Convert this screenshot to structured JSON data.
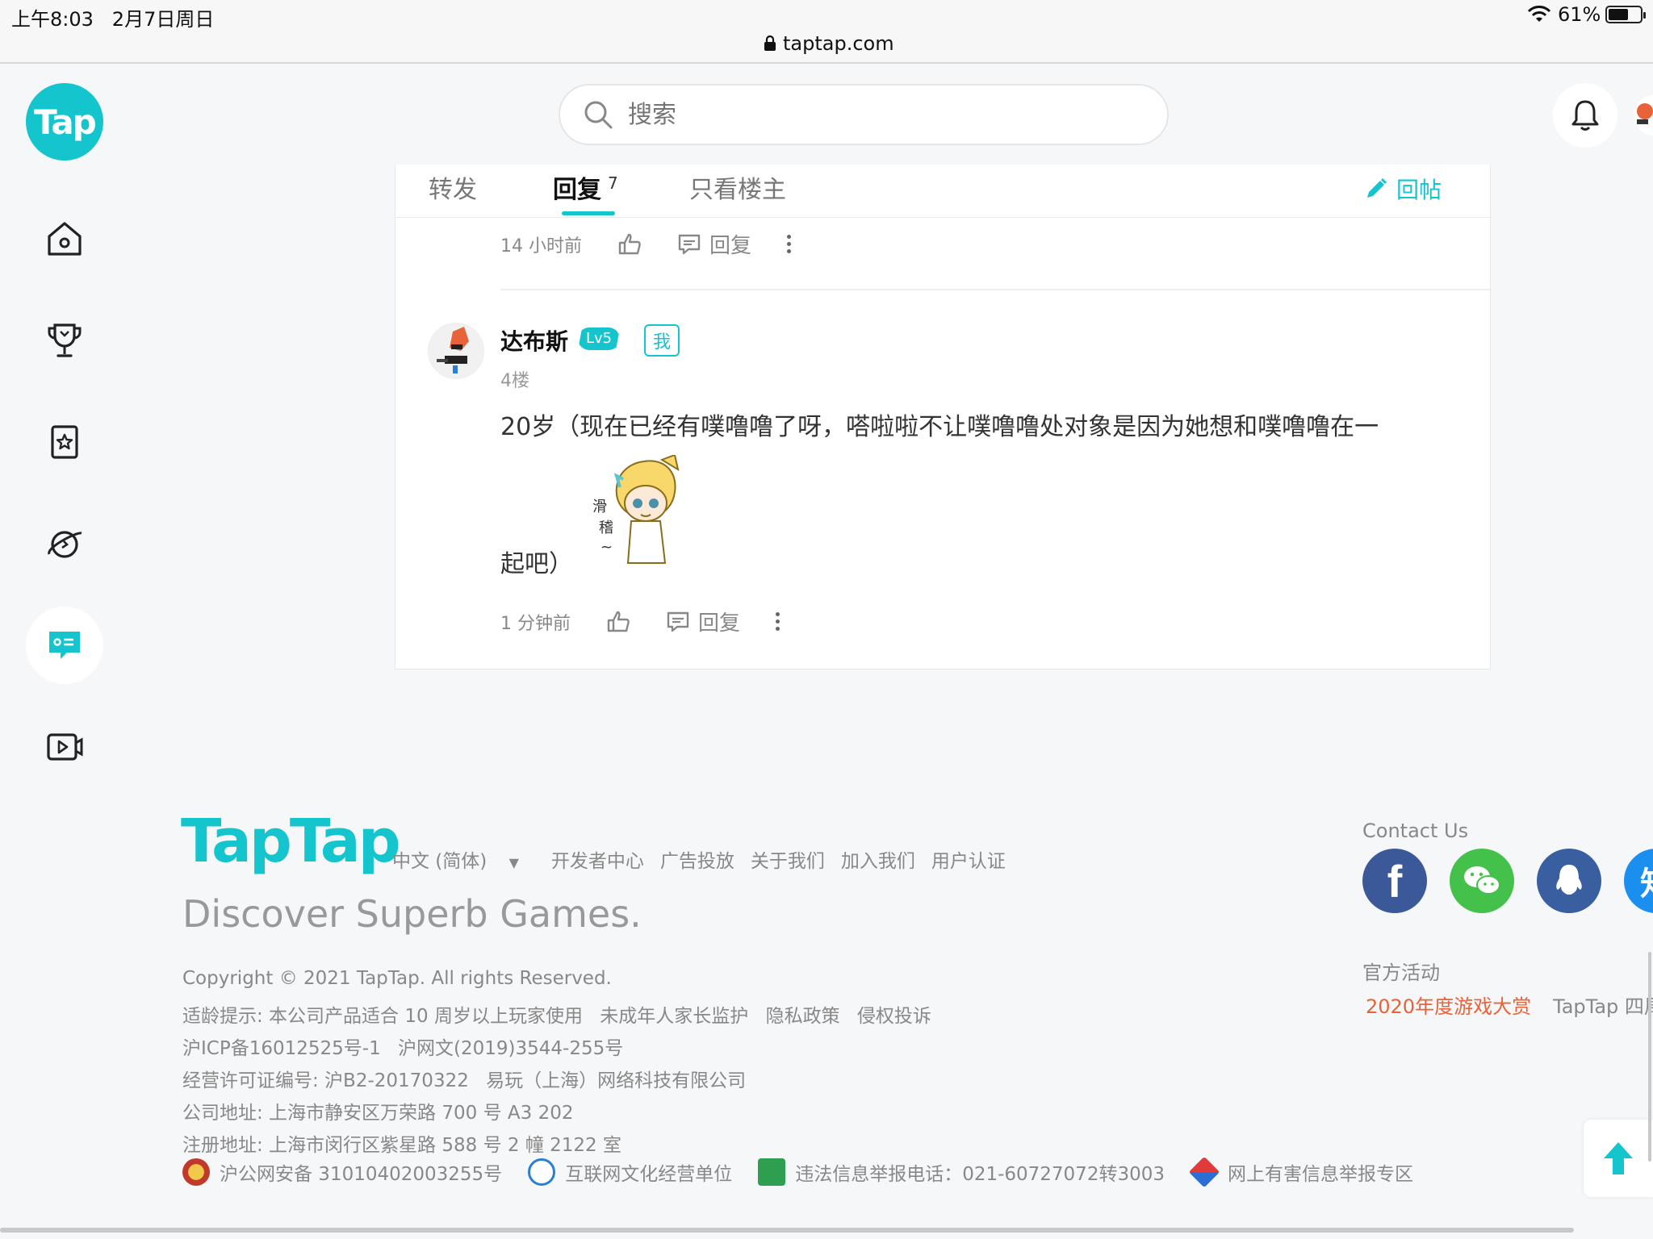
{
  "status_bar": {
    "time": "上午8:03",
    "date": "2月7日周日",
    "url": "taptap.com",
    "battery": "61%"
  },
  "header": {
    "logo_text": "Tap",
    "search_placeholder": "搜索"
  },
  "tabs": {
    "forward": "转发",
    "reply": "回复",
    "reply_count": "7",
    "owner_only": "只看楼主",
    "post_reply": "回帖"
  },
  "prev_comment": {
    "time": "14 小时前",
    "reply_label": "回复"
  },
  "comment": {
    "username": "达布斯",
    "level": "Lv5",
    "me_badge": "我",
    "floor": "4楼",
    "text_line1": "20岁（现在已经有噗噜噜了呀，嗒啦啦不让噗噜噜处对象是因为她想和噗噜噜在一",
    "text_line2": "起吧）",
    "time": "1 分钟前",
    "reply_label": "回复"
  },
  "footer": {
    "brand": "TapTap",
    "links": [
      "中文 (简体)",
      "开发者中心",
      "广告投放",
      "关于我们",
      "加入我们",
      "用户认证"
    ],
    "slogan": "Discover Superb Games.",
    "copyright": "Copyright © 2021 TapTap. All rights Reserved.",
    "age_notice": "适龄提示: 本公司产品适合 10 周岁以上玩家使用",
    "age_links": [
      "未成年人家长监护",
      "隐私政策",
      "侵权投诉"
    ],
    "icp": "沪ICP备16012525号-1",
    "net_culture": "沪网文(2019)3544-255号",
    "license": "经营许可证编号: 沪B2-20170322",
    "company": "易玩（上海）网络科技有限公司",
    "address": "公司地址: 上海市静安区万荣路 700 号 A3 202",
    "reg_address": "注册地址: 上海市闵行区紫星路 588 号 2 幢 2122 室",
    "police": "沪公网安备 31010402003255号",
    "culture_unit": "互联网文化经营单位",
    "report_phone": "违法信息举报电话：021-60727072转3003",
    "harmful_report": "网上有害信息举报专区",
    "contact_title": "Contact Us",
    "zhihu": "知",
    "official_title": "官方活动",
    "activity_1": "2020年度游戏大赏",
    "activity_2": "TapTap 四周"
  },
  "colors": {
    "accent": "#15c5ce",
    "activity": "#e8633a",
    "facebook": "#3b5998",
    "wechat": "#44c14a",
    "qq": "#3a5fa0",
    "zhihu": "#1a8ff0"
  }
}
